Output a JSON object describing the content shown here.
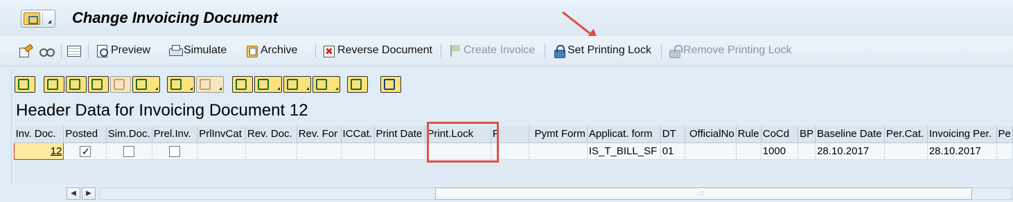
{
  "window": {
    "title": "Change Invoicing Document"
  },
  "toolbar": {
    "preview_label": "Preview",
    "simulate_label": "Simulate",
    "archive_label": "Archive",
    "reverse_label": "Reverse Document",
    "create_invoice_label": "Create Invoice",
    "set_lock_label": "Set Printing Lock",
    "remove_lock_label": "Remove Printing Lock"
  },
  "grid": {
    "title": "Header Data for Invoicing Document 12",
    "columns": [
      "Inv. Doc.",
      "Posted",
      "Sim.Doc.",
      "Prel.Inv.",
      "PrlInvCat",
      "Rev. Doc.",
      "Rev. For",
      "ICCat.",
      "Print Date",
      "Print.Lock",
      "P",
      "Pymt Form",
      "Applicat. form",
      "DT",
      "OfficialNo",
      "Rule",
      "CoCd",
      "BP",
      "Baseline Date",
      "Per.Cat.",
      "Invoicing Per.",
      "Pe"
    ],
    "row": {
      "inv_doc": "12",
      "posted": true,
      "sim_doc": false,
      "prel_inv": false,
      "applicat_form": "IS_T_BILL_SF",
      "dt": "01",
      "cocd": "1000",
      "baseline_date": "28.10.2017",
      "invoicing_per": "28.10.2017"
    }
  },
  "colors": {
    "annotation": "#e05244",
    "selected_cell": "#fde9a0"
  }
}
